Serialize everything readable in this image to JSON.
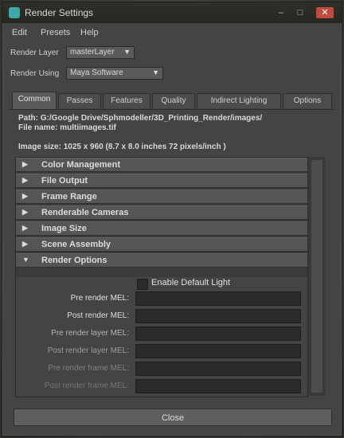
{
  "window": {
    "title": "Render Settings"
  },
  "menu": [
    "Edit",
    "Presets",
    "Help"
  ],
  "render_layer": {
    "label": "Render Layer",
    "value": "masterLayer"
  },
  "render_using": {
    "label": "Render Using",
    "value": "Maya Software"
  },
  "tabs": [
    "Common",
    "Passes",
    "Features",
    "Quality",
    "Indirect Lighting",
    "Options"
  ],
  "path": {
    "line1": "Path: G:/Google Drive/Sphmodeller/3D_Printing_Render/images/",
    "line2": "File name: multiimages.tif"
  },
  "image_size": "Image size: 1025 x 960 (8.7 x 8.0 inches 72 pixels/inch )",
  "sections": [
    {
      "label": "Color Management",
      "expanded": false
    },
    {
      "label": "File Output",
      "expanded": false
    },
    {
      "label": "Frame Range",
      "expanded": false
    },
    {
      "label": "Renderable Cameras",
      "expanded": false
    },
    {
      "label": "Image Size",
      "expanded": false
    },
    {
      "label": "Scene Assembly",
      "expanded": false
    },
    {
      "label": "Render Options",
      "expanded": true
    }
  ],
  "render_options": {
    "enable_default_light": {
      "label": "Enable Default Light",
      "checked": false
    },
    "fields": [
      {
        "label": "Pre render MEL:",
        "value": ""
      },
      {
        "label": "Post render MEL:",
        "value": ""
      },
      {
        "label": "Pre render layer MEL:",
        "value": ""
      },
      {
        "label": "Post render layer MEL:",
        "value": ""
      },
      {
        "label": "Pre render frame MEL:",
        "value": ""
      },
      {
        "label": "Post render frame MEL:",
        "value": ""
      }
    ]
  },
  "close_button": "Close",
  "colors": {
    "title_icon": "#3ea8a8",
    "close_button": "#c04a3c"
  }
}
